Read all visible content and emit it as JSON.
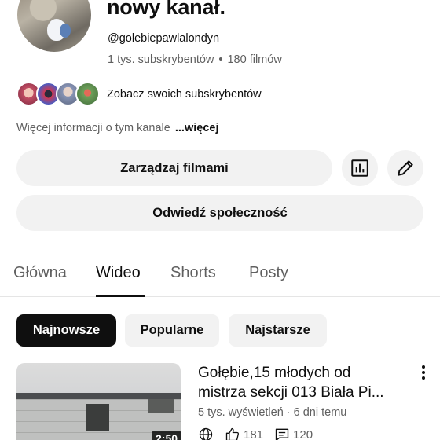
{
  "channel": {
    "name": "nowy kanał.",
    "handle": "@golebiepawlalondyn",
    "subscribers": "1 tys. subskrybentów",
    "separator": "•",
    "videos": "180 filmów"
  },
  "subscribers_row": {
    "label": "Zobacz swoich subskrybentów"
  },
  "about": {
    "text": "Więcej informacji o tym kanale",
    "more_link": "...więcej"
  },
  "buttons": {
    "manage_videos": "Zarządzaj filmami",
    "visit_community": "Odwiedź społeczność",
    "analytics_icon": "bar-chart-icon",
    "edit_icon": "pencil-icon"
  },
  "tabs": [
    {
      "label": "Główna",
      "active": false
    },
    {
      "label": "Wideo",
      "active": true
    },
    {
      "label": "Shorts",
      "active": false
    },
    {
      "label": "Posty",
      "active": false
    }
  ],
  "filters": [
    {
      "label": "Najnowsze",
      "active": true
    },
    {
      "label": "Popularne",
      "active": false
    },
    {
      "label": "Najstarsze",
      "active": false
    }
  ],
  "video": {
    "title_line1": "Gołębie,15 młodych od",
    "title_line2": "mistrza sekcji 013 Biała Pi...",
    "views": "5 tys. wyświetleń",
    "separator": "·",
    "age": "6 dni temu",
    "duration": "2:50",
    "likes": "181",
    "comments": "120"
  },
  "colors": {
    "text_primary": "#0f0f0f",
    "text_secondary": "#606060",
    "button_bg": "#f2f2f2",
    "chip_active_bg": "#0f0f0f"
  }
}
